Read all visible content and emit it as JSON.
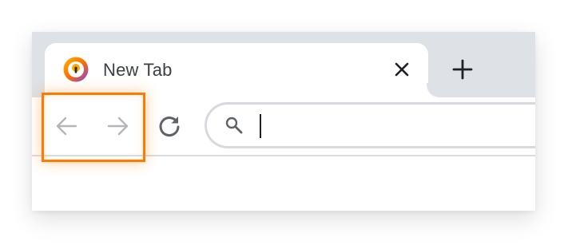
{
  "tab": {
    "title": "New Tab",
    "favicon": "avast-secure-browser-icon",
    "close_icon": "close-icon"
  },
  "tabstrip": {
    "new_tab_icon": "plus-icon"
  },
  "toolbar": {
    "back_icon": "arrow-left-icon",
    "forward_icon": "arrow-right-icon",
    "reload_icon": "reload-icon",
    "back_enabled": false,
    "forward_enabled": false
  },
  "omnibox": {
    "value": "",
    "search_icon": "search-icon"
  },
  "highlight": {
    "target": "back-forward-buttons",
    "color": "#ff7a00"
  },
  "colors": {
    "tabstrip_background": "#dee1e6",
    "tab_background": "#ffffff",
    "disabled_icon": "#b4b6ba",
    "active_icon": "#5f6368",
    "highlight": "#ff7a00"
  }
}
